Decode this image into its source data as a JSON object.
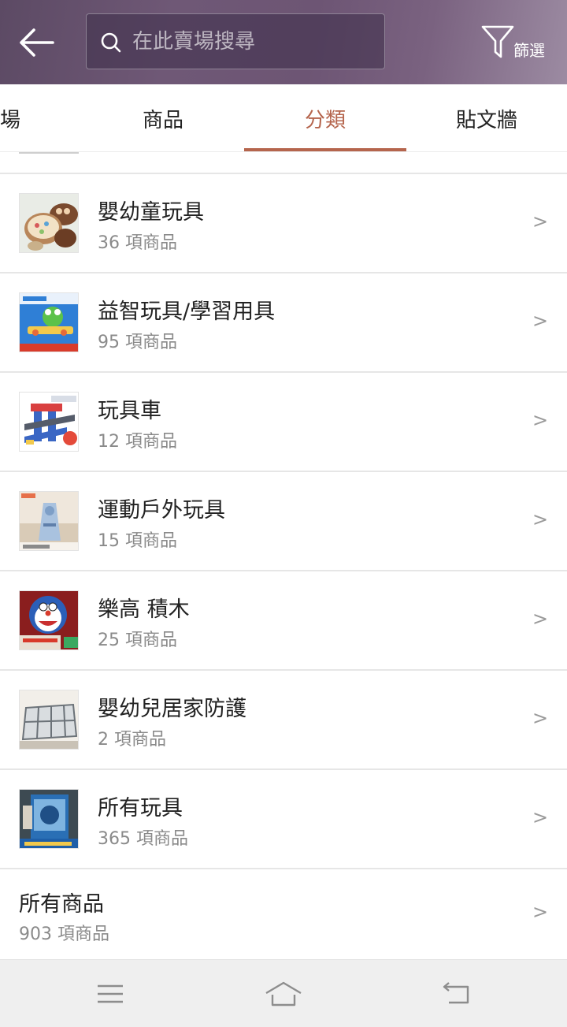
{
  "header": {
    "search": {
      "placeholder": "在此賣場搜尋"
    },
    "filter_label": "篩選"
  },
  "tabs": [
    {
      "label": "場",
      "active": false
    },
    {
      "label": "商品",
      "active": false
    },
    {
      "label": "分類",
      "active": true
    },
    {
      "label": "貼文牆",
      "active": false
    }
  ],
  "categories": [
    {
      "title": "嬰幼童玩具",
      "count": "36 項商品",
      "thumbnail": "cake-toy-thumbnail"
    },
    {
      "title": "益智玩具/學習用具",
      "count": "95 項商品",
      "thumbnail": "frog-game-thumbnail"
    },
    {
      "title": "玩具車",
      "count": "12 項商品",
      "thumbnail": "car-track-thumbnail"
    },
    {
      "title": "運動戶外玩具",
      "count": "15 項商品",
      "thumbnail": "outdoor-toy-thumbnail"
    },
    {
      "title": "樂高 積木",
      "count": "25 項商品",
      "thumbnail": "doraemon-blocks-thumbnail"
    },
    {
      "title": "嬰幼兒居家防護",
      "count": "2 項商品",
      "thumbnail": "playpen-thumbnail"
    },
    {
      "title": "所有玩具",
      "count": "365 項商品",
      "thumbnail": "toy-box-thumbnail"
    },
    {
      "title": "所有商品",
      "count": "903 項商品",
      "thumbnail": null
    }
  ],
  "chevron": ">",
  "colors": {
    "accent": "#b5654d",
    "header_bg": "#6d5574",
    "muted_text": "#8a8a8a",
    "divider": "#e6e6e6",
    "navbar_bg": "#efefef"
  },
  "icons": {
    "back": "arrow-left-icon",
    "search": "search-icon",
    "filter": "funnel-icon",
    "row_chevron": "chevron-right-icon",
    "nav_menu": "menu-icon",
    "nav_home": "home-icon",
    "nav_back": "return-icon"
  }
}
